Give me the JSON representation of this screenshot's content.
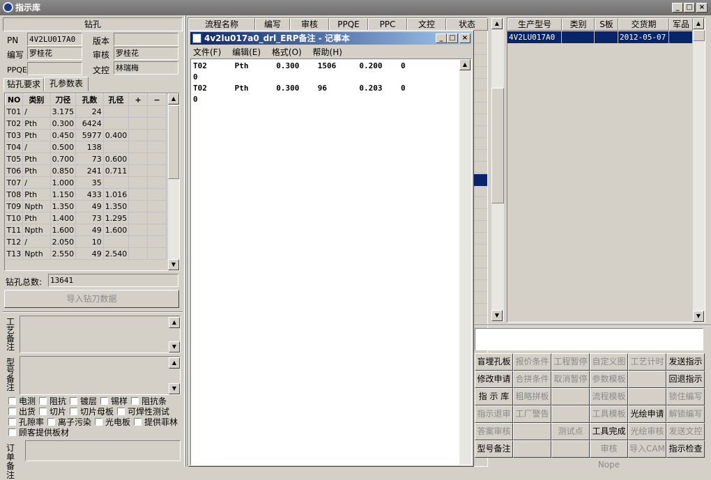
{
  "window": {
    "title": "指示库",
    "btn_min": "_",
    "btn_max": "□",
    "btn_close": "×"
  },
  "drill": {
    "title": "钻孔",
    "pn_label": "PN",
    "pn_value": "4V2LU017A0",
    "version_label": "版本",
    "version_value": "",
    "writer_label": "编写",
    "writer_value": "罗桂花",
    "review_label": "审核",
    "review_value": "罗桂花",
    "ppqe_label": "PPQE",
    "ppqe_value": "",
    "doc_label": "文控",
    "doc_value": "林瑞梅",
    "tabs": [
      "钻孔要求",
      "孔参数表"
    ],
    "columns": [
      "NO",
      "类别",
      "刀径",
      "孔数",
      "孔径",
      "+",
      "−"
    ],
    "rows": [
      [
        "T01",
        "/",
        "3.175",
        "24",
        ""
      ],
      [
        "T02",
        "Pth",
        "0.300",
        "6424",
        ""
      ],
      [
        "T03",
        "Pth",
        "0.450",
        "5977",
        "0.400"
      ],
      [
        "T04",
        "/",
        "0.500",
        "138",
        ""
      ],
      [
        "T05",
        "Pth",
        "0.700",
        "73",
        "0.600"
      ],
      [
        "T06",
        "Pth",
        "0.850",
        "241",
        "0.711"
      ],
      [
        "T07",
        "/",
        "1.000",
        "35",
        ""
      ],
      [
        "T08",
        "Pth",
        "1.150",
        "433",
        "1.016"
      ],
      [
        "T09",
        "Npth",
        "1.350",
        "49",
        "1.350"
      ],
      [
        "T10",
        "Pth",
        "1.400",
        "73",
        "1.295"
      ],
      [
        "T11",
        "Npth",
        "1.600",
        "49",
        "1.600"
      ],
      [
        "T12",
        "/",
        "2.050",
        "10",
        ""
      ],
      [
        "T13",
        "Npth",
        "2.550",
        "49",
        "2.540"
      ]
    ],
    "total_label": "钻孔总数:",
    "total_value": "13641",
    "import_button": "导入钻刀数据",
    "process_note_label": "工艺备注",
    "model_note_label": "型号备注",
    "checkboxes": [
      [
        "电测",
        "阻抗",
        "镀层",
        "锡样",
        "阻抗条"
      ],
      [
        "出货",
        "切片",
        "切片母板",
        "可焊性测试"
      ],
      [
        "孔隙率",
        "离子污染",
        "光电板",
        "提供菲林"
      ],
      [
        "顾客提供板材"
      ]
    ],
    "order_note_label": "订单备注"
  },
  "flow": {
    "columns": [
      "流程名称",
      "编写",
      "审核",
      "PPQE",
      "PPC",
      "文控",
      "状态"
    ]
  },
  "notepad": {
    "title": "4v2lu017a0_drl_ERP备注 - 记事本",
    "menu": [
      "文件(F)",
      "编辑(E)",
      "格式(O)",
      "帮助(H)"
    ],
    "lines": [
      "T02      Pth      0.300    1506     0.200    0",
      "0",
      "T02      Pth      0.300    96       0.203    0",
      "0"
    ]
  },
  "model_list": {
    "columns": [
      "生产型号",
      "类别",
      "S板",
      "交货期",
      "军品"
    ],
    "rows": [
      [
        "4V2LU017A0",
        "",
        "",
        "2012-05-07",
        ""
      ]
    ]
  },
  "func_buttons": [
    [
      {
        "label": "盲埋孔板",
        "enabled": true
      },
      {
        "label": "报价条件",
        "enabled": false
      },
      {
        "label": "工程暂停",
        "enabled": false
      },
      {
        "label": "自定义图",
        "enabled": false
      },
      {
        "label": "工艺计时",
        "enabled": false
      },
      {
        "label": "发送指示",
        "enabled": true
      }
    ],
    [
      {
        "label": "修改申请",
        "enabled": true
      },
      {
        "label": "合拼条件",
        "enabled": false
      },
      {
        "label": "取消暂停",
        "enabled": false
      },
      {
        "label": "参数模板",
        "enabled": false
      },
      {
        "label": "",
        "enabled": false
      },
      {
        "label": "回退指示",
        "enabled": true
      }
    ],
    [
      {
        "label": "指 示 库",
        "enabled": true
      },
      {
        "label": "粗略拼板",
        "enabled": false
      },
      {
        "label": "",
        "enabled": false
      },
      {
        "label": "流程模板",
        "enabled": false
      },
      {
        "label": "",
        "enabled": false
      },
      {
        "label": "锁住编写",
        "enabled": false
      }
    ],
    [
      {
        "label": "指示退审",
        "enabled": false
      },
      {
        "label": "工厂警告",
        "enabled": false
      },
      {
        "label": "",
        "enabled": false
      },
      {
        "label": "工具模板",
        "enabled": false
      },
      {
        "label": "光绘申请",
        "enabled": true
      },
      {
        "label": "解锁编写",
        "enabled": false
      }
    ],
    [
      {
        "label": "答案审核",
        "enabled": false
      },
      {
        "label": "",
        "enabled": false
      },
      {
        "label": "测试点",
        "enabled": false
      },
      {
        "label": "工具完成",
        "enabled": true
      },
      {
        "label": "光绘审核",
        "enabled": false
      },
      {
        "label": "发送文控",
        "enabled": false
      }
    ],
    [
      {
        "label": "型号备注",
        "enabled": true
      },
      {
        "label": "",
        "enabled": false
      },
      {
        "label": "",
        "enabled": false
      },
      {
        "label": "审核Nope",
        "enabled": false
      },
      {
        "label": "导入CAM",
        "enabled": false
      },
      {
        "label": "指示检查",
        "enabled": true
      }
    ]
  ]
}
